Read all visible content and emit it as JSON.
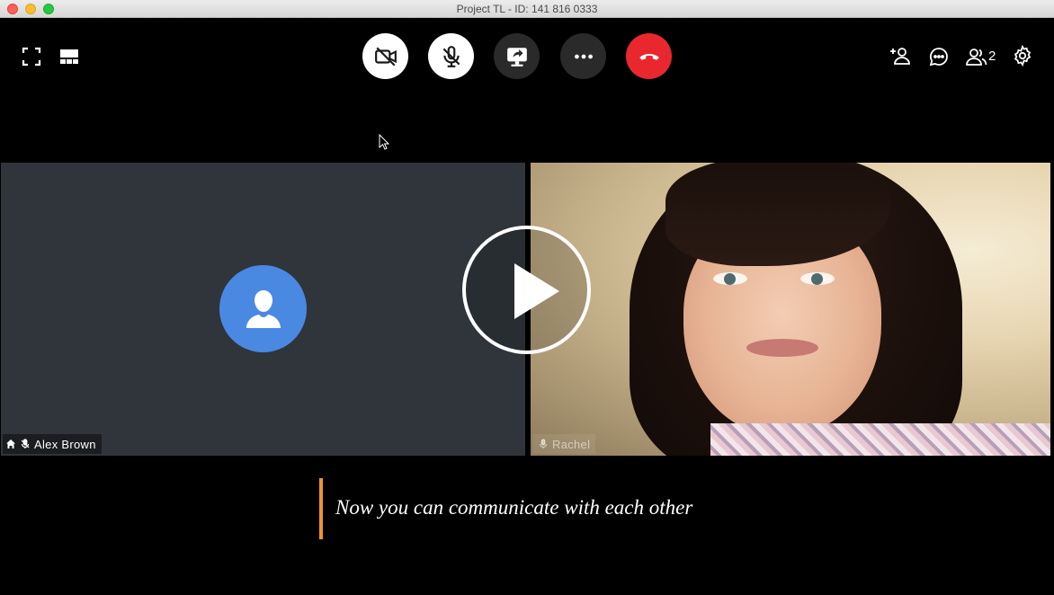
{
  "window": {
    "title": "Project TL - ID: 141 816 0333"
  },
  "toolbar_left": {
    "fullscreen_icon": "fullscreen-icon",
    "layout_icon": "gallery-layout-icon"
  },
  "controls": [
    {
      "name": "camera-toggle-button",
      "icon": "video-off-icon",
      "style": "light"
    },
    {
      "name": "mic-toggle-button",
      "icon": "mic-off-icon",
      "style": "light"
    },
    {
      "name": "share-screen-button",
      "icon": "screen-share-icon",
      "style": "dark"
    },
    {
      "name": "more-button",
      "icon": "more-dots-icon",
      "style": "dark"
    },
    {
      "name": "end-call-button",
      "icon": "hang-up-icon",
      "style": "red"
    }
  ],
  "toolbar_right": {
    "invite_icon": "add-person-icon",
    "chat_icon": "chat-icon",
    "participants_icon": "participants-icon",
    "participants_count": "2",
    "settings_icon": "gear-icon"
  },
  "tiles": [
    {
      "name": "Alex Brown",
      "video": false,
      "muted": true,
      "host": true
    },
    {
      "name": "Rachel",
      "video": true,
      "muted": true,
      "host": false
    }
  ],
  "caption": {
    "text": "Now you can communicate with each other",
    "accent_color": "#f2922e"
  },
  "colors": {
    "end_call": "#e8282e",
    "avatar": "#4a89e2",
    "tile_bg": "#30353b"
  }
}
